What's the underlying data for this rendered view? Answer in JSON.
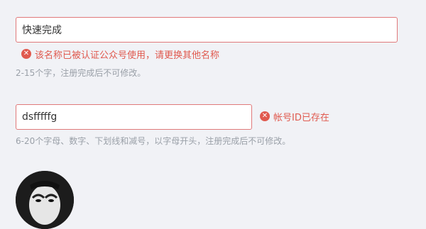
{
  "name_field": {
    "value": "快速完成",
    "error": "该名称已被认证公众号使用，请更换其他名称",
    "hint": "2-15个字，注册完成后不可修改。"
  },
  "id_field": {
    "value": "dsfffffg",
    "error": "帐号ID已存在",
    "hint": "6-20个字母、数字、下划线和减号，以字母开头，注册完成后不可修改。"
  },
  "icons": {
    "error_icon": "close-circle-icon",
    "error_glyph": "✕"
  },
  "colors": {
    "error": "#e05a4f",
    "input_border_error": "#e0797a",
    "hint": "#9aa0a8",
    "background": "#f1f2f6"
  }
}
